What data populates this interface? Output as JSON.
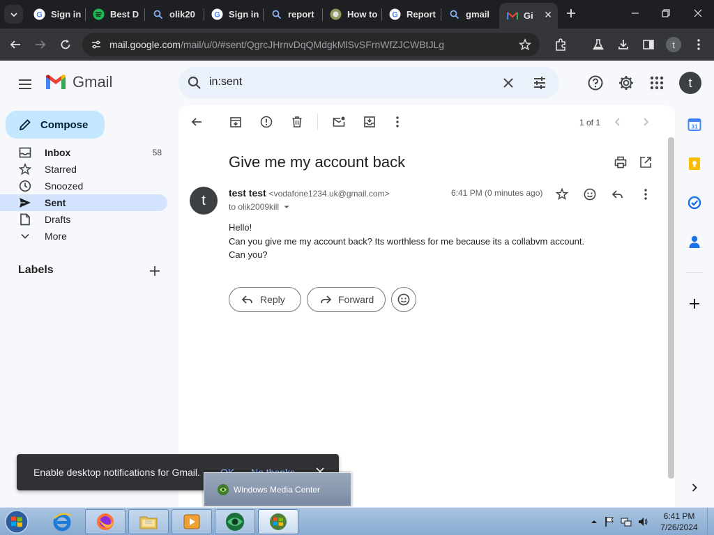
{
  "browser": {
    "tabs": [
      {
        "label": "Sign in",
        "icon": "google-g-icon"
      },
      {
        "label": "Best D",
        "icon": "green-site-icon"
      },
      {
        "label": "olik20",
        "icon": "search-icon"
      },
      {
        "label": "Sign in",
        "icon": "google-g-icon"
      },
      {
        "label": "report",
        "icon": "search-icon"
      },
      {
        "label": "How to",
        "icon": "site-icon"
      },
      {
        "label": "Report",
        "icon": "google-g-icon"
      },
      {
        "label": "gmail",
        "icon": "search-icon"
      },
      {
        "label": "Gi",
        "icon": "gmail-icon"
      }
    ],
    "url_host": "mail.google.com",
    "url_path": "/mail/u/0/#sent/QgrcJHrnvDqQMdgkMlSvSFrnWfZJCWBtJLg",
    "avatar_letter": "t"
  },
  "gmail": {
    "brand": "Gmail",
    "search_query": "in:sent",
    "account_letter": "t",
    "compose_label": "Compose",
    "nav": [
      {
        "label": "Inbox",
        "count": "58",
        "icon": "inbox-icon"
      },
      {
        "label": "Starred",
        "count": "",
        "icon": "star-icon"
      },
      {
        "label": "Snoozed",
        "count": "",
        "icon": "clock-icon"
      },
      {
        "label": "Sent",
        "count": "",
        "icon": "send-icon"
      },
      {
        "label": "Drafts",
        "count": "",
        "icon": "draft-icon"
      },
      {
        "label": "More",
        "count": "",
        "icon": "chevron-down-icon"
      }
    ],
    "labels_heading": "Labels",
    "pager": "1 of 1",
    "message": {
      "subject": "Give me my account back",
      "sender_name": "test test",
      "sender_email": "<vodafone1234.uk@gmail.com>",
      "to": "to olik2009kill",
      "time": "6:41 PM (0 minutes ago)",
      "avatar_letter": "t",
      "body": [
        "Hello!",
        "Can you give me my account back? Its worthless for me because its a collabvm account.",
        "Can you?"
      ]
    },
    "reply_label": "Reply",
    "forward_label": "Forward"
  },
  "notification": {
    "text": "Enable desktop notifications for Gmail.",
    "ok": "OK",
    "no_thanks": "No thanks"
  },
  "taskbar": {
    "tooltip": "Windows Media Center",
    "clock_time": "6:41 PM",
    "clock_date": "7/26/2024"
  },
  "colors": {
    "chrome_dark": "#1e1f22",
    "chrome_toolbar": "#35363a",
    "gmail_bg": "#f6f8fc",
    "compose": "#c2e7ff",
    "nav_active": "#d3e3fd",
    "search_bg": "#eaf1fb"
  }
}
